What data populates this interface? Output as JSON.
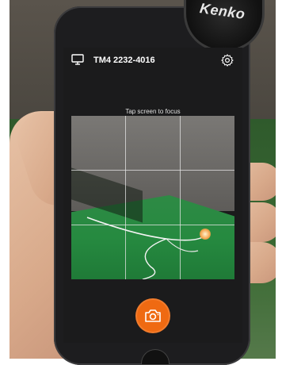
{
  "header": {
    "device_name": "TM4 2232-4016",
    "left_icon": "display-icon",
    "right_icon": "gear-icon"
  },
  "preview": {
    "focus_hint": "Tap screen to focus",
    "grid": "3x3"
  },
  "shutter": {
    "icon": "camera-icon",
    "color": "#ef6a12"
  },
  "backdrop": {
    "lens_cap_text": "Kenko"
  }
}
